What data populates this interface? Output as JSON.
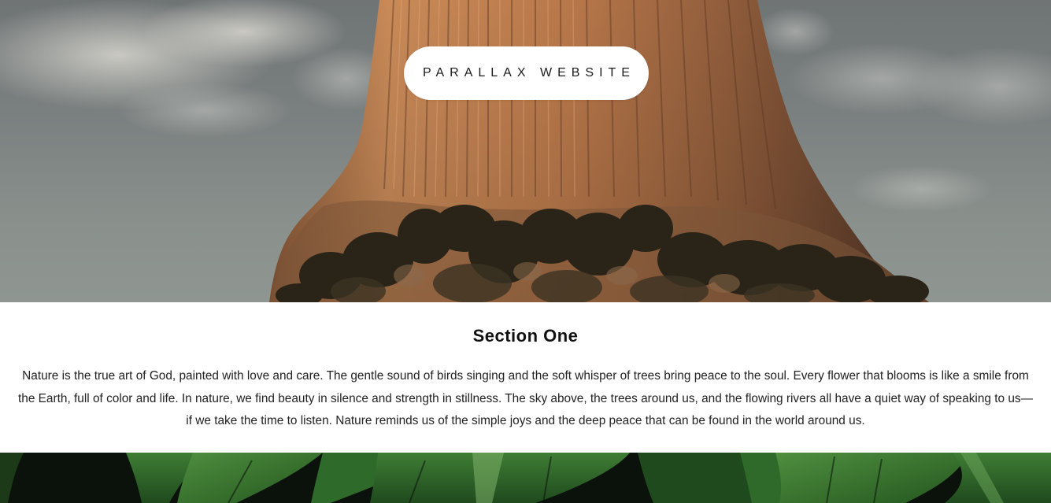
{
  "hero": {
    "title": "PARALLAX WEBSITE"
  },
  "section_one": {
    "heading": "Section One",
    "body": "Nature is the true art of God, painted with love and care. The gentle sound of birds singing and the soft whisper of trees bring peace to the soul. Every flower that blooms is like a smile from the Earth, full of color and life. In nature, we find beauty in silence and strength in stillness. The sky above, the trees around us, and the flowing rivers all have a quiet way of speaking to us—if we take the time to listen. Nature reminds us of the simple joys and the deep peace that can be found in the world around us."
  },
  "colors": {
    "sky": "#7b8180",
    "rock": "#b9784a",
    "rock_shadow": "#6e4630",
    "foliage": "#2a2a1c",
    "leaf": "#2f6a2a",
    "leaf_dark": "#0c120c",
    "section_bg": "#ffffff",
    "text": "#222222"
  }
}
